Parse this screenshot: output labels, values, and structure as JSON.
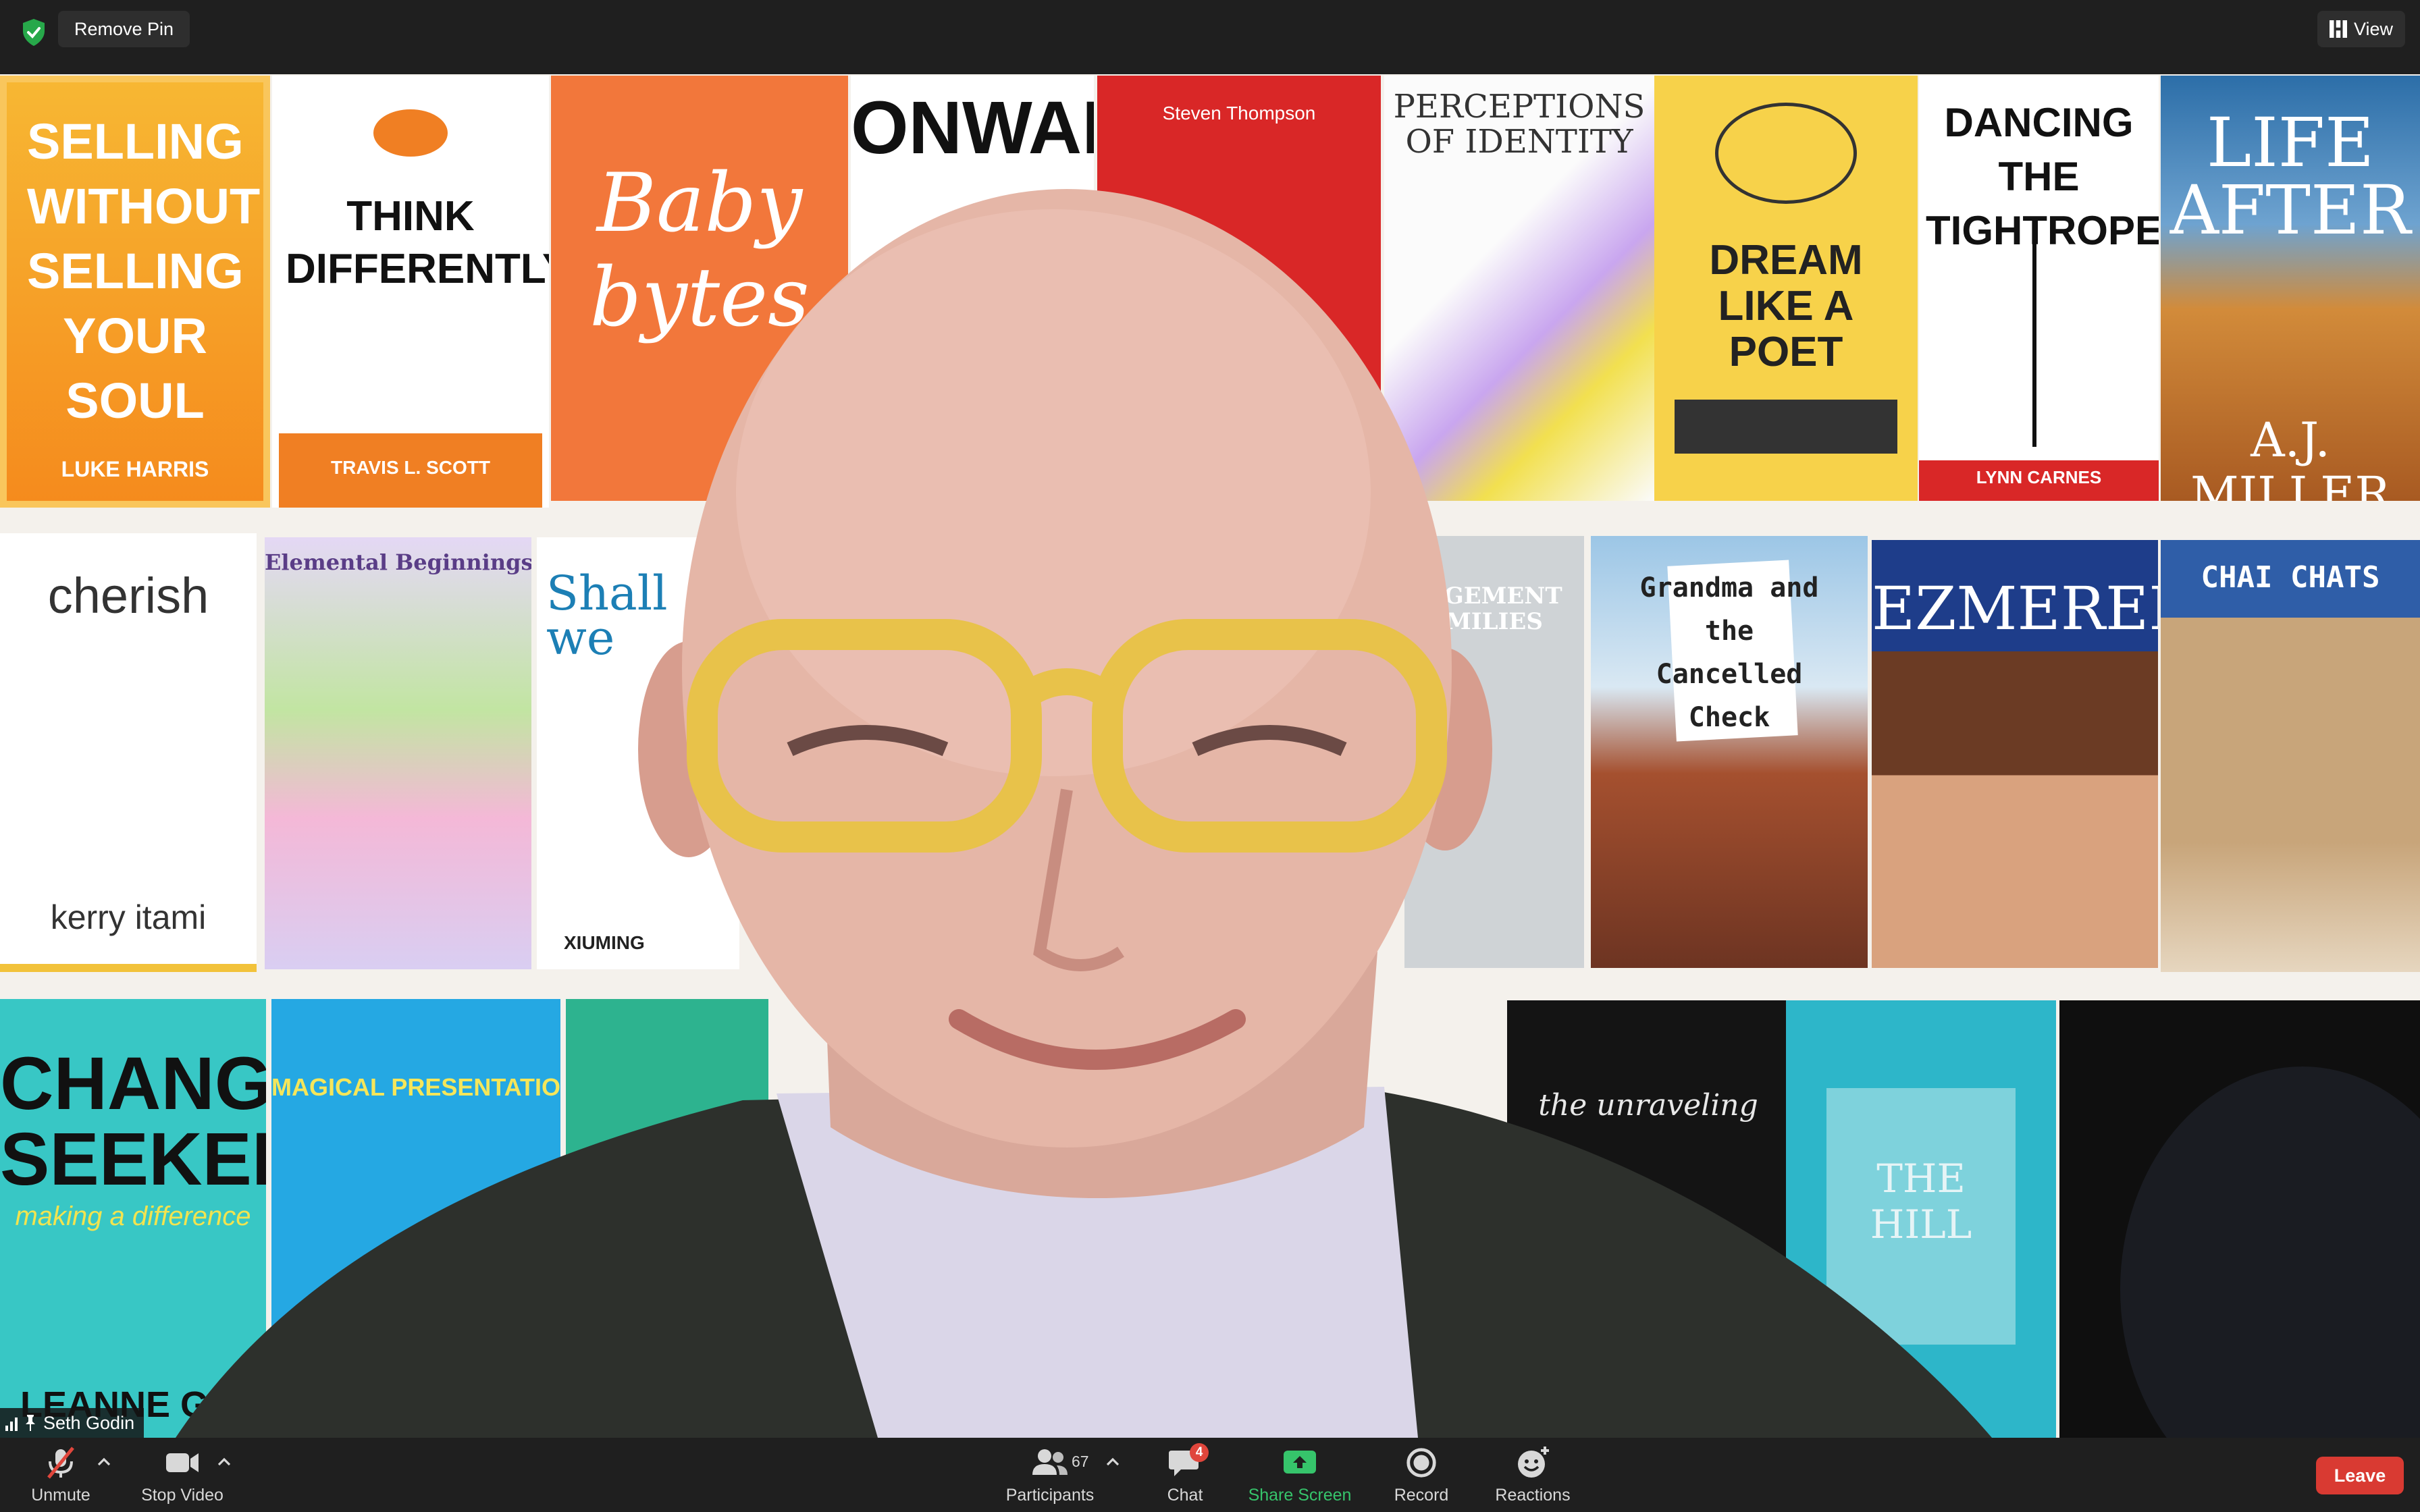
{
  "topbar": {
    "remove_pin_label": "Remove Pin",
    "view_label": "View"
  },
  "video": {
    "participant_name": "Seth Godin",
    "background_books": [
      {
        "title": "SELLING WITHOUT SELLING YOUR SOUL",
        "author": "LUKE HARRIS"
      },
      {
        "title": "THINK DIFFERENTLY",
        "author": "TRAVIS L. SCOTT"
      },
      {
        "title": "Baby bytes",
        "author": ""
      },
      {
        "title": "ONWARD",
        "author": ""
      },
      {
        "title": "",
        "author": "Steven Thompson"
      },
      {
        "title": "PERCEPTIONS OF IDENTITY",
        "author": ""
      },
      {
        "title": "DREAM LIKE A POET",
        "author": ""
      },
      {
        "title": "DANCING THE TIGHTROPE",
        "author": "LYNN CARNES"
      },
      {
        "title": "LIFE AFTER",
        "author": "A.J. MILLER"
      },
      {
        "title": "cherish",
        "author": "kerry itami"
      },
      {
        "title": "Elemental Beginnings",
        "author": ""
      },
      {
        "title": "Shall we",
        "author": "XIUMING"
      },
      {
        "title": "AGEMENT MILIES",
        "author": ""
      },
      {
        "title": "Grandma and the Cancelled Check",
        "author": ""
      },
      {
        "title": "EZMERELDA",
        "author": ""
      },
      {
        "title": "CHAI CHATS",
        "author": ""
      },
      {
        "title": "CHANGE SEEKERS",
        "author": "LEANNE G"
      },
      {
        "title": "MAGICAL PRESENTATIONS",
        "author": ""
      },
      {
        "title": "the unraveling",
        "author": ""
      },
      {
        "title": "THE HILL",
        "author": ""
      }
    ],
    "book_subtitles": {
      "change_seekers": "making a difference"
    }
  },
  "toolbar": {
    "unmute_label": "Unmute",
    "stop_video_label": "Stop Video",
    "participants_label": "Participants",
    "participants_count": "67",
    "chat_label": "Chat",
    "chat_badge": "4",
    "share_screen_label": "Share Screen",
    "record_label": "Record",
    "reactions_label": "Reactions",
    "leave_label": "Leave"
  },
  "colors": {
    "toolbar_bg": "#1f1f1f",
    "share_green": "#36c46b",
    "leave_red": "#d93a32",
    "badge_red": "#e0463c"
  }
}
